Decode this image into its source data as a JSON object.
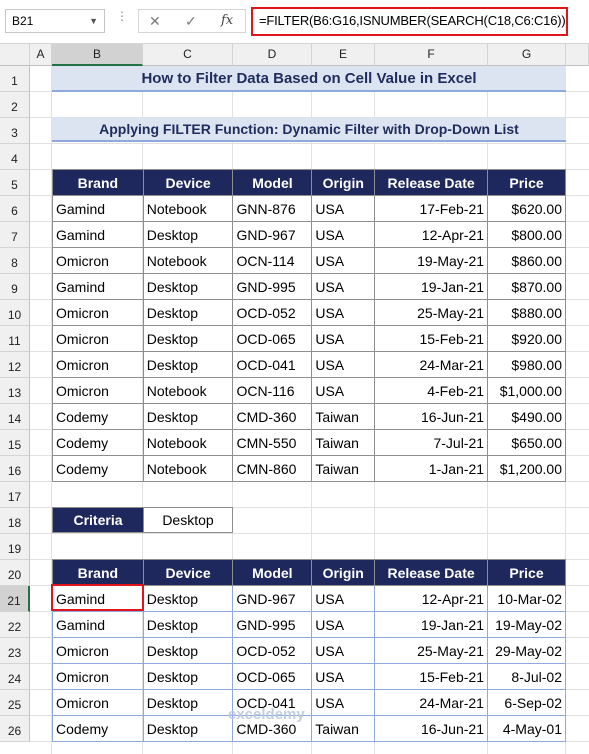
{
  "formula_bar": {
    "name_box": "B21",
    "formula": "=FILTER(B6:G16,ISNUMBER(SEARCH(C18,C6:C16)))"
  },
  "columns": [
    "A",
    "B",
    "C",
    "D",
    "E",
    "F",
    "G"
  ],
  "rows": [
    "1",
    "2",
    "3",
    "4",
    "5",
    "6",
    "7",
    "8",
    "9",
    "10",
    "11",
    "12",
    "13",
    "14",
    "15",
    "16",
    "17",
    "18",
    "19",
    "20",
    "21",
    "22",
    "23",
    "24",
    "25",
    "26"
  ],
  "title": "How to Filter Data Based on Cell Value in Excel",
  "subtitle": "Applying FILTER Function: Dynamic Filter with Drop-Down List",
  "main_table": {
    "headers": [
      "Brand",
      "Device",
      "Model",
      "Origin",
      "Release Date",
      "Price"
    ],
    "rows": [
      [
        "Gamind",
        "Notebook",
        "GNN-876",
        "USA",
        "17-Feb-21",
        "$620.00"
      ],
      [
        "Gamind",
        "Desktop",
        "GND-967",
        "USA",
        "12-Apr-21",
        "$800.00"
      ],
      [
        "Omicron",
        "Notebook",
        "OCN-114",
        "USA",
        "19-May-21",
        "$860.00"
      ],
      [
        "Gamind",
        "Desktop",
        "GND-995",
        "USA",
        "19-Jan-21",
        "$870.00"
      ],
      [
        "Omicron",
        "Desktop",
        "OCD-052",
        "USA",
        "25-May-21",
        "$880.00"
      ],
      [
        "Omicron",
        "Desktop",
        "OCD-065",
        "USA",
        "15-Feb-21",
        "$920.00"
      ],
      [
        "Omicron",
        "Desktop",
        "OCD-041",
        "USA",
        "24-Mar-21",
        "$980.00"
      ],
      [
        "Omicron",
        "Notebook",
        "OCN-116",
        "USA",
        "4-Feb-21",
        "$1,000.00"
      ],
      [
        "Codemy",
        "Desktop",
        "CMD-360",
        "Taiwan",
        "16-Jun-21",
        "$490.00"
      ],
      [
        "Codemy",
        "Notebook",
        "CMN-550",
        "Taiwan",
        "7-Jul-21",
        "$650.00"
      ],
      [
        "Codemy",
        "Notebook",
        "CMN-860",
        "Taiwan",
        "1-Jan-21",
        "$1,200.00"
      ]
    ]
  },
  "criteria": {
    "label": "Criteria",
    "value": "Desktop"
  },
  "result_table": {
    "headers": [
      "Brand",
      "Device",
      "Model",
      "Origin",
      "Release Date",
      "Price"
    ],
    "rows": [
      [
        "Gamind",
        "Desktop",
        "GND-967",
        "USA",
        "12-Apr-21",
        "10-Mar-02"
      ],
      [
        "Gamind",
        "Desktop",
        "GND-995",
        "USA",
        "19-Jan-21",
        "19-May-02"
      ],
      [
        "Omicron",
        "Desktop",
        "OCD-052",
        "USA",
        "25-May-21",
        "29-May-02"
      ],
      [
        "Omicron",
        "Desktop",
        "OCD-065",
        "USA",
        "15-Feb-21",
        "8-Jul-02"
      ],
      [
        "Omicron",
        "Desktop",
        "OCD-041",
        "USA",
        "24-Mar-21",
        "6-Sep-02"
      ],
      [
        "Codemy",
        "Desktop",
        "CMD-360",
        "Taiwan",
        "16-Jun-21",
        "4-May-01"
      ]
    ]
  },
  "watermark": "exceldemy",
  "colors": {
    "header_bg": "#1f285c",
    "banner_bg": "#dce3f1",
    "selection": "#e1141b"
  }
}
